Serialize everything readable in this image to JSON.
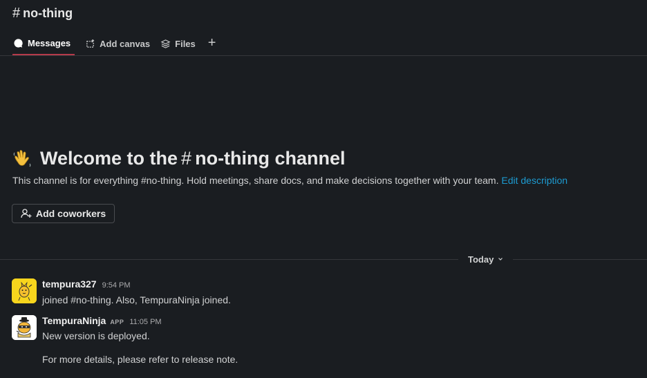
{
  "channel": {
    "hash": "#",
    "name": "no-thing"
  },
  "tabs": [
    {
      "label": "Messages",
      "icon": "message-icon",
      "active": true
    },
    {
      "label": "Add canvas",
      "icon": "canvas-icon",
      "active": false
    },
    {
      "label": "Files",
      "icon": "files-icon",
      "active": false
    }
  ],
  "tab_add": "+",
  "welcome": {
    "prefix": "Welcome to the",
    "hash": "#",
    "name": "no-thing channel",
    "description": "This channel is for everything #no-thing. Hold meetings, share docs, and make decisions together with your team.",
    "edit_link": "Edit description"
  },
  "add_coworkers": "Add coworkers",
  "date_divider": "Today",
  "messages": [
    {
      "author": "tempura327",
      "time": "9:54 PM",
      "lines": [
        "joined #no-thing. Also, TempuraNinja joined."
      ],
      "avatar": "yellow-character-avatar"
    },
    {
      "author": "TempuraNinja",
      "badge": "APP",
      "time": "11:05 PM",
      "lines": [
        "New version is deployed.",
        "For more details, please refer to release note."
      ],
      "avatar": "ninja-avatar"
    }
  ],
  "colors": {
    "background": "#1a1d21",
    "link": "#1d9bd1",
    "active_tab_underline": "#b43a4a"
  }
}
